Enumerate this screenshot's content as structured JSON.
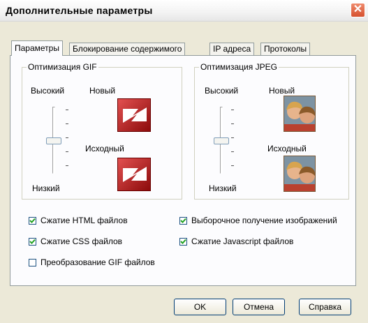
{
  "window": {
    "title": "Дополнительные параметры",
    "close_glyph": "✕"
  },
  "tabs": [
    {
      "label": "Параметры",
      "active": true
    },
    {
      "label": "Блокирование содержимого",
      "active": false
    },
    {
      "label": "IP адреса",
      "active": false
    },
    {
      "label": "Протоколы",
      "active": false
    }
  ],
  "gif": {
    "legend": "Оптимизация GIF",
    "high_label": "Высокий",
    "low_label": "Низкий",
    "new_label": "Новый",
    "original_label": "Исходный",
    "slider_level": 0.5,
    "icon": "envelope-logo-icon"
  },
  "jpeg": {
    "legend": "Оптимизация JPEG",
    "high_label": "Высокий",
    "low_label": "Низкий",
    "new_label": "Новый",
    "original_label": "Исходный",
    "slider_level": 0.5,
    "icon": "children-photo-icon"
  },
  "checkboxes": {
    "html": {
      "label": "Сжатие HTML файлов",
      "checked": true
    },
    "css": {
      "label": "Сжатие CSS файлов",
      "checked": true
    },
    "gif_convert": {
      "label": "Преобразование GIF файлов",
      "checked": false
    },
    "selective_images": {
      "label": "Выборочное получение изображений",
      "checked": true
    },
    "js": {
      "label": "Сжатие Javascript файлов",
      "checked": true
    }
  },
  "buttons": {
    "ok": "OK",
    "cancel": "Отмена",
    "help": "Справка"
  },
  "colors": {
    "close_red": "#d6512f",
    "gif_red": "#b01a1a",
    "border_blue": "#003c74"
  }
}
